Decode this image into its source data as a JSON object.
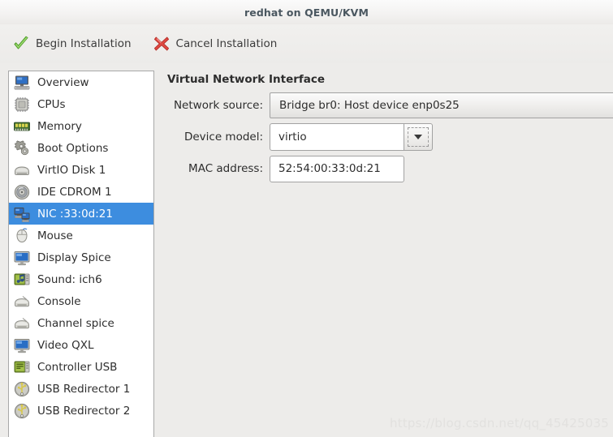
{
  "window": {
    "title": "redhat on QEMU/KVM"
  },
  "toolbar": {
    "buttons": [
      {
        "label": "Begin Installation",
        "icon": "check-icon",
        "name": "begin-installation-button"
      },
      {
        "label": "Cancel Installation",
        "icon": "cross-icon",
        "name": "cancel-installation-button"
      }
    ]
  },
  "sidebar": {
    "items": [
      {
        "label": "Overview",
        "icon": "computer-icon",
        "selected": false
      },
      {
        "label": "CPUs",
        "icon": "cpu-chip-icon",
        "selected": false
      },
      {
        "label": "Memory",
        "icon": "memory-ram-icon",
        "selected": false
      },
      {
        "label": "Boot Options",
        "icon": "gears-icon",
        "selected": false
      },
      {
        "label": "VirtIO Disk 1",
        "icon": "harddisk-icon",
        "selected": false
      },
      {
        "label": "IDE CDROM 1",
        "icon": "cdrom-disc-icon",
        "selected": false
      },
      {
        "label": "NIC :33:0d:21",
        "icon": "network-card-icon",
        "selected": true
      },
      {
        "label": "Mouse",
        "icon": "mouse-icon",
        "selected": false
      },
      {
        "label": "Display Spice",
        "icon": "display-icon",
        "selected": false
      },
      {
        "label": "Sound: ich6",
        "icon": "soundcard-icon",
        "selected": false
      },
      {
        "label": "Console",
        "icon": "console-icon",
        "selected": false
      },
      {
        "label": "Channel spice",
        "icon": "console-icon",
        "selected": false
      },
      {
        "label": "Video QXL",
        "icon": "display-icon",
        "selected": false
      },
      {
        "label": "Controller USB",
        "icon": "controller-icon",
        "selected": false
      },
      {
        "label": "USB Redirector 1",
        "icon": "usb-icon",
        "selected": false
      },
      {
        "label": "USB Redirector 2",
        "icon": "usb-icon",
        "selected": false
      }
    ]
  },
  "detail": {
    "title": "Virtual Network Interface",
    "fields": {
      "network_source": {
        "label": "Network source:",
        "value": "Bridge br0: Host device enp0s25"
      },
      "device_model": {
        "label": "Device model:",
        "value": "virtio"
      },
      "mac_address": {
        "label": "MAC address:",
        "value": "52:54:00:33:0d:21"
      }
    }
  },
  "watermark": {
    "text": "https://blog.csdn.net/qq_45425035"
  },
  "colors": {
    "selection_blue": "#3d8ddf",
    "window_bg": "#edecea",
    "title_text": "#4a5760"
  }
}
